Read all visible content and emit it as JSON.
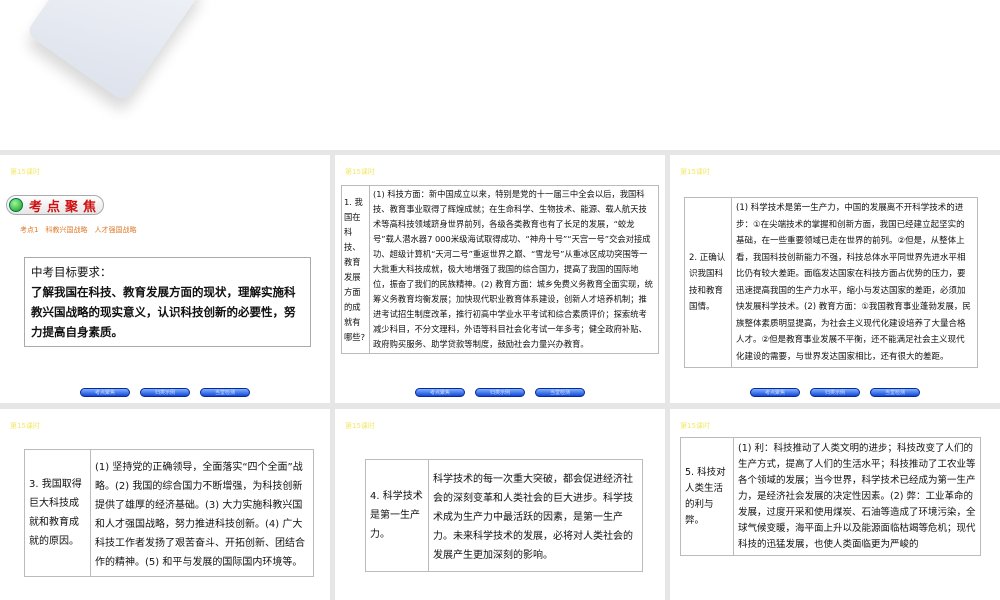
{
  "lesson_label": "第15课时",
  "nav_buttons": [
    "考点聚焦",
    "归类示例",
    "当堂检测"
  ],
  "slide1": {
    "badge": "考点聚焦",
    "subtitle": "考点1　科教兴国战略　人才强国战略",
    "goal_title": "中考目标要求：",
    "goal_text": "了解我国在科技、教育发展方面的现状，理解实施科教兴国战略的现实意义，认识科技创新的必要性，努力提高自身素质。"
  },
  "slide2": {
    "q": "1. 我国在科技、教育发展方面的成就有哪些?",
    "a": "(1) 科技方面：新中国成立以来，特别是党的十一届三中全会以后，我国科技、教育事业取得了辉煌成就；在生命科学、生物技术、能源、载人航天技术等高科技领域跻身世界前列，各级各类教育也有了长足的发展，“蛟龙号”载人潜水器7 000米级海试取得成功、“神舟十号”“天宫一号”交会对接成功、超级计算机“天河二号”重返世界之巅、“雪龙号”从重冰区成功突围等一大批重大科技成就，极大地增强了我国的综合国力，提高了我国的国际地位，振奋了我们的民族精神。(2) 教育方面：城乡免费义务教育全面实现，统筹义务教育均衡发展；加快现代职业教育体系建设，创新人才培养机制；推进考试招生制度改革，推行初高中学业水平考试和综合素质评价；探索统考减少科目，不分文理科，外语等科目社会化考试一年多考；健全政府补贴、政府购买服务、助学贷款等制度，鼓励社会力量兴办教育。"
  },
  "slide3": {
    "q": "2. 正确认识我国科技和教育国情。",
    "a": "(1) 科学技术是第一生产力，中国的发展离不开科学技术的进步：①在尖端技术的掌握和创新方面，我国已经建立起坚实的基础，在一些重要领域已走在世界的前列。②但是，从整体上看，我国科技创新能力不强，科技总体水平同世界先进水平相比仍有较大差距。面临发达国家在科技方面占优势的压力，要迅速提高我国的生产力水平，缩小与发达国家的差距，必须加快发展科学技术。(2) 教育方面：①我国教育事业蓬勃发展，民族整体素质明显提高，为社会主义现代化建设培养了大量合格人才。②但是教育事业发展不平衡，还不能满足社会主义现代化建设的需要，与世界发达国家相比，还有很大的差距。"
  },
  "slide4": {
    "q": "3. 我国取得巨大科技成就和教育成就的原因。",
    "a": "(1) 坚持党的正确领导，全面落实“四个全面”战略。(2) 我国的综合国力不断增强，为科技创新提供了雄厚的经济基础。(3) 大力实施科教兴国和人才强国战略，努力推进科技创新。(4) 广大科技工作者发扬了艰苦奋斗、开拓创新、团结合作的精神。(5) 和平与发展的国际国内环境等。"
  },
  "slide5": {
    "q": "4. 科学技术是第一生产力。",
    "a": "科学技术的每一次重大突破，都会促进经济社会的深刻变革和人类社会的巨大进步。科学技术成为生产力中最活跃的因素，是第一生产力。未来科学技术的发展，必将对人类社会的发展产生更加深刻的影响。"
  },
  "slide6": {
    "q": "5. 科技对人类生活的利与弊。",
    "a": "(1) 利：科技推动了人类文明的进步；科技改变了人们的生产方式，提高了人们的生活水平；科技推动了工农业等各个领域的发展；当今世界，科学技术已经成为第一生产力，是经济社会发展的决定性因素。(2) 弊：工业革命的发展，过度开采和使用煤炭、石油等造成了环境污染，全球气候变暖，海平面上升以及能源面临枯竭等危机；现代科技的迅猛发展，也使人类面临更为严峻的"
  }
}
